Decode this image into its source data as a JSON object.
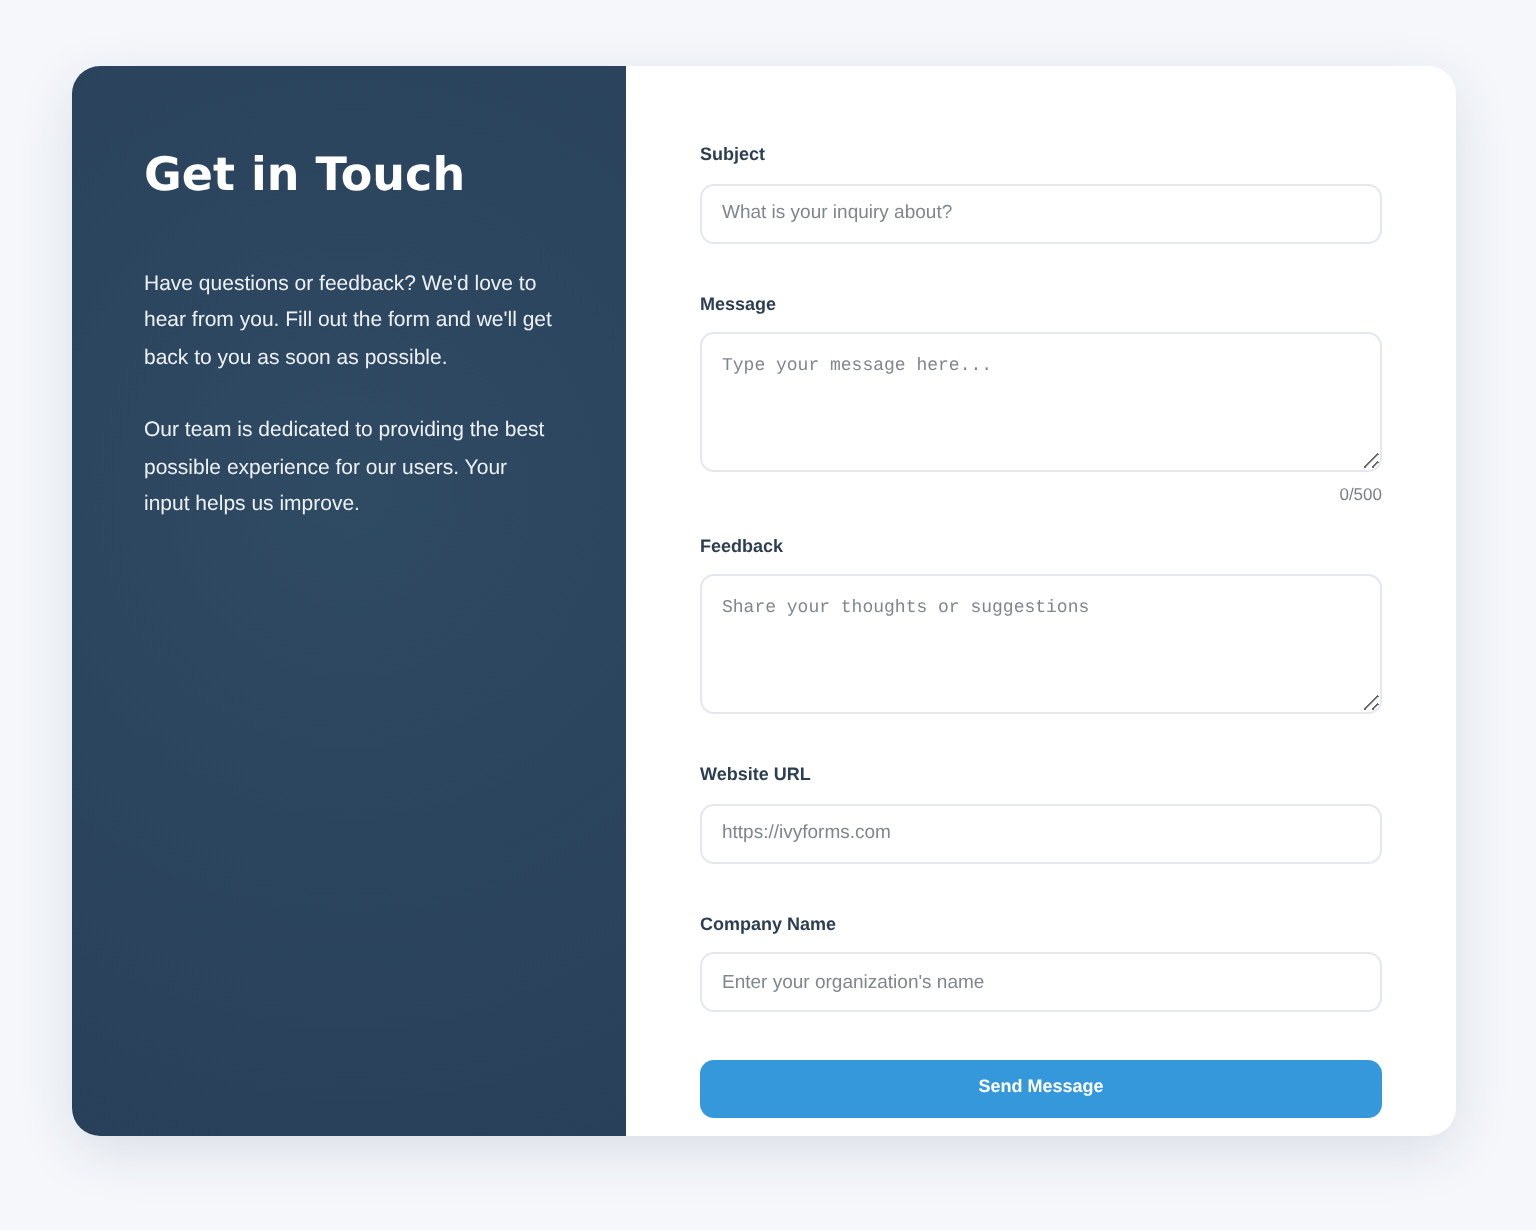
{
  "intro": {
    "title": "Get in Touch",
    "paragraphs": [
      "Have questions or feedback? We'd love to hear from you. Fill out the form and we'll get back to you as soon as possible.",
      "Our team is dedicated to providing the best possible experience for our users. Your input helps us improve."
    ]
  },
  "form": {
    "fields": [
      {
        "kind": "input",
        "label": "Subject",
        "placeholder": "What is your inquiry about?"
      },
      {
        "kind": "textarea",
        "label": "Message",
        "placeholder": "Type your message here...",
        "counter": "0/500"
      },
      {
        "kind": "textarea",
        "label": "Feedback",
        "placeholder": "Share your thoughts or suggestions"
      },
      {
        "kind": "input",
        "label": "Website URL",
        "placeholder": "https://ivyforms.com"
      },
      {
        "kind": "input",
        "label": "Company Name",
        "placeholder": "Enter your organization's name"
      }
    ],
    "submit": "Send Message"
  }
}
